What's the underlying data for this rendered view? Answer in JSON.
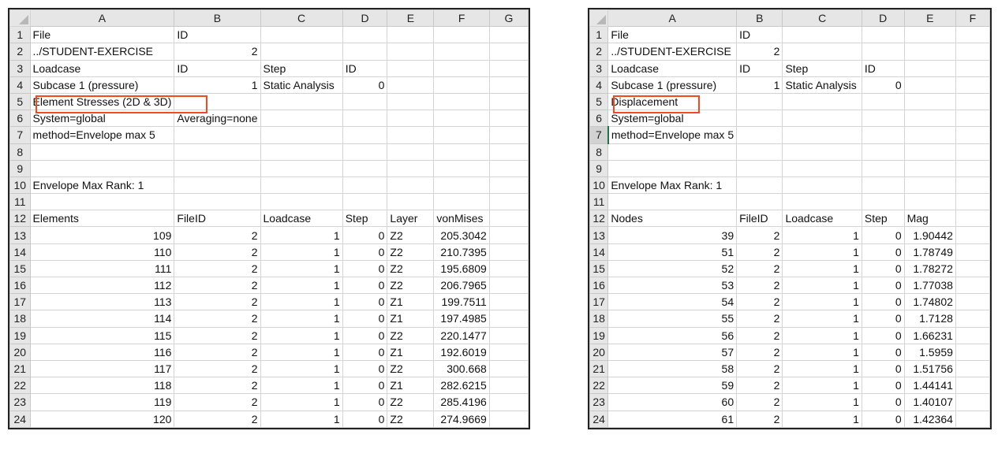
{
  "left": {
    "columns": [
      "A",
      "B",
      "C",
      "D",
      "E",
      "F",
      "G"
    ],
    "rows": [
      [
        "File",
        "ID",
        "",
        "",
        "",
        "",
        ""
      ],
      [
        "../STUDENT-EXERCISE",
        "2",
        "",
        "",
        "",
        "",
        ""
      ],
      [
        "Loadcase",
        "ID",
        "Step",
        "ID",
        "",
        "",
        ""
      ],
      [
        "Subcase 1 (pressure)",
        "1",
        "Static Analysis",
        "0",
        "",
        "",
        ""
      ],
      [
        "Element Stresses (2D & 3D)",
        "",
        "",
        "",
        "",
        "",
        ""
      ],
      [
        "System=global",
        "Averaging=none",
        "",
        "",
        "",
        "",
        ""
      ],
      [
        "method=Envelope max 5",
        "",
        "",
        "",
        "",
        "",
        ""
      ],
      [
        "",
        "",
        "",
        "",
        "",
        "",
        ""
      ],
      [
        "",
        "",
        "",
        "",
        "",
        "",
        ""
      ],
      [
        "Envelope Max Rank: 1",
        "",
        "",
        "",
        "",
        "",
        ""
      ],
      [
        "",
        "",
        "",
        "",
        "",
        "",
        ""
      ],
      [
        "Elements",
        "FileID",
        "Loadcase",
        "Step",
        "Layer",
        "vonMises",
        ""
      ],
      [
        "109",
        "2",
        "1",
        "0",
        "Z2",
        "205.3042",
        ""
      ],
      [
        "110",
        "2",
        "1",
        "0",
        "Z2",
        "210.7395",
        ""
      ],
      [
        "111",
        "2",
        "1",
        "0",
        "Z2",
        "195.6809",
        ""
      ],
      [
        "112",
        "2",
        "1",
        "0",
        "Z2",
        "206.7965",
        ""
      ],
      [
        "113",
        "2",
        "1",
        "0",
        "Z1",
        "199.7511",
        ""
      ],
      [
        "114",
        "2",
        "1",
        "0",
        "Z1",
        "197.4985",
        ""
      ],
      [
        "115",
        "2",
        "1",
        "0",
        "Z2",
        "220.1477",
        ""
      ],
      [
        "116",
        "2",
        "1",
        "0",
        "Z1",
        "192.6019",
        ""
      ],
      [
        "117",
        "2",
        "1",
        "0",
        "Z2",
        "300.668",
        ""
      ],
      [
        "118",
        "2",
        "1",
        "0",
        "Z1",
        "282.6215",
        ""
      ],
      [
        "119",
        "2",
        "1",
        "0",
        "Z2",
        "285.4196",
        ""
      ],
      [
        "120",
        "2",
        "1",
        "0",
        "Z2",
        "274.9669",
        ""
      ]
    ]
  },
  "right": {
    "columns": [
      "A",
      "B",
      "C",
      "D",
      "E",
      "F"
    ],
    "rows": [
      [
        "File",
        "ID",
        "",
        "",
        "",
        ""
      ],
      [
        "../STUDENT-EXERCISE",
        "2",
        "",
        "",
        "",
        ""
      ],
      [
        "Loadcase",
        "ID",
        "Step",
        "ID",
        "",
        ""
      ],
      [
        "Subcase 1 (pressure)",
        "1",
        "Static Analysis",
        "0",
        "",
        ""
      ],
      [
        "Displacement",
        "",
        "",
        "",
        "",
        ""
      ],
      [
        "System=global",
        "",
        "",
        "",
        "",
        ""
      ],
      [
        "method=Envelope max 5",
        "",
        "",
        "",
        "",
        ""
      ],
      [
        "",
        "",
        "",
        "",
        "",
        ""
      ],
      [
        "",
        "",
        "",
        "",
        "",
        ""
      ],
      [
        "Envelope Max Rank: 1",
        "",
        "",
        "",
        "",
        ""
      ],
      [
        "",
        "",
        "",
        "",
        "",
        ""
      ],
      [
        "Nodes",
        "FileID",
        "Loadcase",
        "Step",
        "Mag",
        ""
      ],
      [
        "39",
        "2",
        "1",
        "0",
        "1.90442",
        ""
      ],
      [
        "51",
        "2",
        "1",
        "0",
        "1.78749",
        ""
      ],
      [
        "52",
        "2",
        "1",
        "0",
        "1.78272",
        ""
      ],
      [
        "53",
        "2",
        "1",
        "0",
        "1.77038",
        ""
      ],
      [
        "54",
        "2",
        "1",
        "0",
        "1.74802",
        ""
      ],
      [
        "55",
        "2",
        "1",
        "0",
        "1.7128",
        ""
      ],
      [
        "56",
        "2",
        "1",
        "0",
        "1.66231",
        ""
      ],
      [
        "57",
        "2",
        "1",
        "0",
        "1.5959",
        ""
      ],
      [
        "58",
        "2",
        "1",
        "0",
        "1.51756",
        ""
      ],
      [
        "59",
        "2",
        "1",
        "0",
        "1.44141",
        ""
      ],
      [
        "60",
        "2",
        "1",
        "0",
        "1.40107",
        ""
      ],
      [
        "61",
        "2",
        "1",
        "0",
        "1.42364",
        ""
      ]
    ]
  },
  "colors": {
    "highlight": "#f04a1e",
    "header_bg": "#e6e6e6",
    "active_cell_border": "#217346"
  }
}
